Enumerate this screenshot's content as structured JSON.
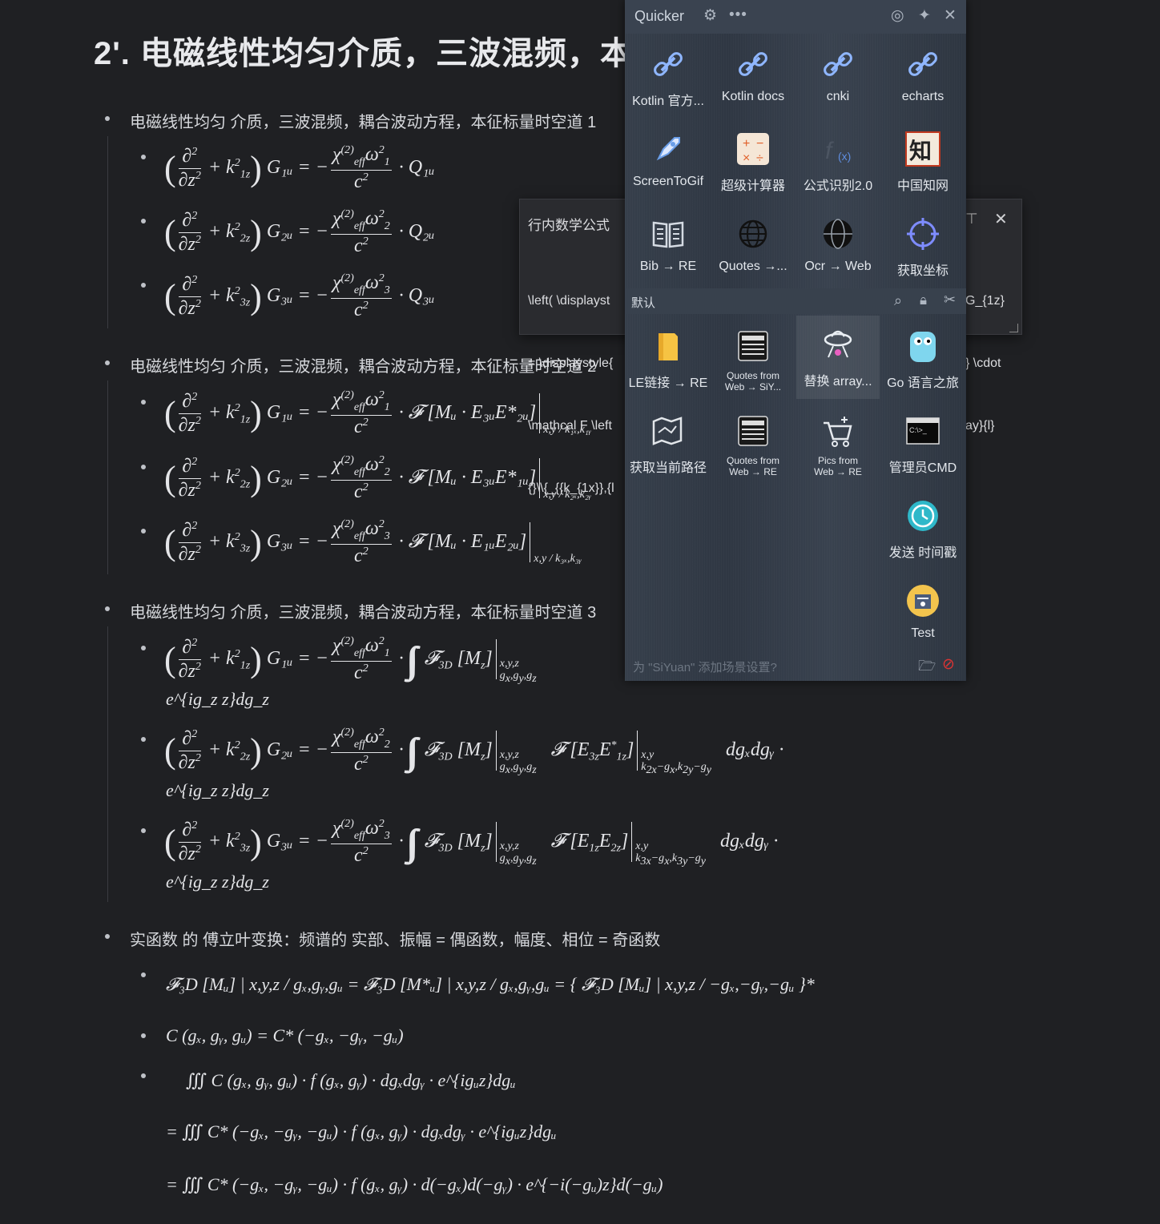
{
  "document": {
    "title": "2'. 电磁线性均匀介质，三波混频，本",
    "sections": [
      {
        "text": "电磁线性均匀 介质，三波混频，耦合波动方程，本征标量时空道 1"
      },
      {
        "text": "电磁线性均匀 介质，三波混频，耦合波动方程，本征标量时空道 2"
      },
      {
        "text": "电磁线性均匀 介质，三波混频，耦合波动方程，本征标量时空道 3"
      },
      {
        "text": "实函数 的 傅立叶变换：频谱的 实部、振幅 = 偶函数，幅度、相位 = 奇函数"
      }
    ],
    "eq": {
      "lhs_G1": "G₁ᵤ",
      "lhs_G2": "G₂ᵤ",
      "lhs_G3": "G₃ᵤ",
      "Q1": "· Q₁ᵤ",
      "Q2": "· Q₂ᵤ",
      "Q3": "· Q₃ᵤ",
      "F1": "· 𝓕 [Mᵤ · E₃ᵤE*₂ᵤ]",
      "F2": "· 𝓕 [Mᵤ · E₃ᵤE*₁ᵤ]",
      "F3": "· 𝓕 [Mᵤ · E₁ᵤE₂ᵤ]",
      "eval1": "x,y / k₁ₓ,k₁ᵧ",
      "eval2": "x,y / k₂ₓ,k₂ᵧ",
      "eval3": "x,y / k₃ₓ,k₃ᵧ",
      "tail": "dgₓdgᵧ ·",
      "exp": "e^{ig_z z}dg_z",
      "ft1": "𝓕₃D [Mᵤ] | x,y,z / gₓ,gᵧ,gᵤ  = 𝓕₃D [M*ᵤ] | x,y,z / gₓ,gᵧ,gᵤ  = { 𝓕₃D [Mᵤ] | x,y,z / −gₓ,−gᵧ,−gᵤ }*",
      "ft2": "C (gₓ, gᵧ, gᵤ) = C* (−gₓ, −gᵧ, −gᵤ)",
      "ft3": "∭ C (gₓ, gᵧ, gᵤ) · f (gₓ, gᵧ) · dgₓdgᵧ · e^{igᵤz}dgᵤ",
      "ft4": "= ∭ C* (−gₓ, −gᵧ, −gᵤ) · f (gₓ, gᵧ) · dgₓdgᵧ · e^{igᵤz}dgᵤ",
      "ft5": "= ∭ C* (−gₓ, −gᵧ, −gᵤ) · f (gₓ, gᵧ) · d(−gₓ)d(−gᵧ) · e^{−i(−gᵤ)z}d(−gᵤ)"
    }
  },
  "inline_popup": {
    "title": "行内数学公式",
    "code_lines": [
      "\\left( \\displayst",
      "= \\displaystyle{",
      "\\mathcal F \\left",
      "{}\\\\{_{{k_{1x}},{l"
    ],
    "code_right": [
      "G_{1z}",
      "} \\cdot",
      "ay}{l}"
    ]
  },
  "quicker": {
    "title": "Quicker",
    "scene_label": "默认",
    "footer_hint": "为 \"SiYuan\" 添加场景设置?",
    "top_items": [
      {
        "label": "Kotlin 官方...",
        "icon": "link-icon"
      },
      {
        "label": "Kotlin docs",
        "icon": "link-icon"
      },
      {
        "label": "cnki",
        "icon": "link-icon"
      },
      {
        "label": "echarts",
        "icon": "link-icon"
      },
      {
        "label": "ScreenToGif",
        "icon": "rocket-icon"
      },
      {
        "label": "超级计算器",
        "icon": "calculator-icon"
      },
      {
        "label": "公式识别2.0",
        "icon": "formula-icon"
      },
      {
        "label": "中国知网",
        "icon": "cnki-logo-icon"
      },
      {
        "label": "Bib → RE",
        "icon": "book-icon"
      },
      {
        "label": "Quotes →...",
        "icon": "globe-icon"
      },
      {
        "label": "Ocr → Web",
        "icon": "globe-dark-icon"
      },
      {
        "label": "获取坐标",
        "icon": "crosshair-icon"
      }
    ],
    "bottom_items": [
      {
        "label": "LE链接 → RE",
        "icon": "folder-icon"
      },
      {
        "label": "Quotes from\nWeb → SiY...",
        "icon": "news-icon"
      },
      {
        "label": "替换 array...",
        "icon": "ufo-icon"
      },
      {
        "label": "Go 语言之旅",
        "icon": "gopher-icon"
      },
      {
        "label": "获取当前路径",
        "icon": "map-icon"
      },
      {
        "label": "Quotes from\nWeb → RE",
        "icon": "news-icon"
      },
      {
        "label": "Pics from\nWeb → RE",
        "icon": "cart-icon"
      },
      {
        "label": "管理员CMD",
        "icon": "terminal-icon"
      },
      {
        "label": "发送 时间戳",
        "icon": "clock-icon"
      },
      {
        "label": "Test",
        "icon": "badge-icon"
      }
    ]
  }
}
